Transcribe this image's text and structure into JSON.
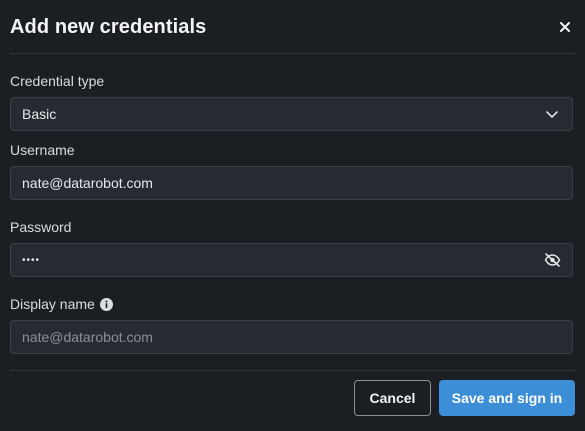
{
  "dialog": {
    "title": "Add new credentials",
    "close_icon": "close-icon"
  },
  "form": {
    "credential_type": {
      "label": "Credential type",
      "value": "Basic",
      "icon": "chevron-down-icon"
    },
    "username": {
      "label": "Username",
      "value": "nate@datarobot.com"
    },
    "password": {
      "label": "Password",
      "masked_value": "••••",
      "icon": "eye-off-icon"
    },
    "display_name": {
      "label": "Display name",
      "placeholder": "nate@datarobot.com",
      "icon": "info-icon"
    }
  },
  "actions": {
    "cancel_label": "Cancel",
    "save_label": "Save and sign in"
  },
  "colors": {
    "background": "#1b1f24",
    "field_background": "#262a31",
    "primary": "#3c8fd6"
  }
}
